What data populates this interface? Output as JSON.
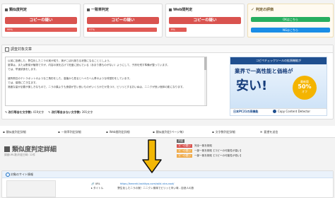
{
  "metrics": [
    {
      "title": "類似度判定",
      "result": "コピーの疑い",
      "bar": "99%",
      "percent": 99
    },
    {
      "title": "一致率判定",
      "result": "コピーの疑い",
      "bar": "97%",
      "percent": 97
    },
    {
      "title": "Web間判定",
      "result": "コピーの疑い",
      "bar": "9%",
      "percent": 9
    }
  ],
  "evaluation": {
    "title": "判定の評価",
    "ok_label": "OKはこちら",
    "ng_label": "NGはこちら"
  },
  "survey": {
    "title": "調査対象文章",
    "lines": [
      "以前に投稿した、野生化したニラの実が成り、実がこぼれ落ちる状態になることとしよう。",
      "夏草は、または野菜が植物ですが、内容の実を広げて旺盛に読んでいる（あまり悪ものがない）ようにして、子孫を残す準備が整っています。",
      "では、早速試食をします。",
      "",
      "諸所周辺のテトラポットのような三角形をした、高植から見るとへぺろへん草のような球型形をしています。",
      "では、保物に亡き生ます。",
      "適度な量が必要が楽しきなもので、ニラの葉よりも食感が甘い良いものがいくらかだか見つけ、ビリリとするおいぬは、ニニクが良い個体の影になります。"
    ],
    "stats": {
      "total_label": "改行等含む文字数:",
      "total_value": "419文字",
      "nospace_label": "改行等含まない文字数:",
      "nospace_value": "391文字"
    }
  },
  "ad": {
    "top_label": "コピペチェックツールの拡張機能が",
    "headline1": "業界で一高性能",
    "headline2": "と価格が",
    "headline3": "安い!",
    "badge1": "最新版",
    "badge2": "50%",
    "badge3": "オフ",
    "brand": "日本PC21の高機能",
    "product": "Copy Content Detector"
  },
  "tabs": [
    "類似度判定詳細",
    "一致率判定詳細",
    "Web間判定詳細",
    "類似度判定(ページ毎)",
    "文字数判定詳細",
    "要望を送信"
  ],
  "detail": {
    "title": "類似度判定詳細",
    "subtitle": "調査URL数/判定日時: 12件",
    "legend": [
      {
        "badge": "判定",
        "text": "判定"
      },
      {
        "badge": "ｺﾋﾟｰの疑い",
        "text": "完全一致を検知"
      },
      {
        "badge": "ｺﾋﾟｰの疑い",
        "text": "一部一致を検知【コピーの可能性が高い】"
      },
      {
        "badge": "ｺﾋﾟｰの疑い",
        "text": "一部一致を検知【コピーの可能性が低い】"
      }
    ]
  },
  "site_info": {
    "title": "対象のサイト情報",
    "url_label": "URL",
    "url_value": "https://kenreki.isshikyo.com/wild-nira-root/",
    "title_label": "タイトル",
    "title_value": "野生化したニラの実！ニニクン風味でビリッと辛い味 - 自然人の旅"
  },
  "colors": {
    "accent": "#d9534f",
    "green": "#27ae60",
    "blue": "#1b8ee6",
    "arrow": "#f2b705"
  }
}
